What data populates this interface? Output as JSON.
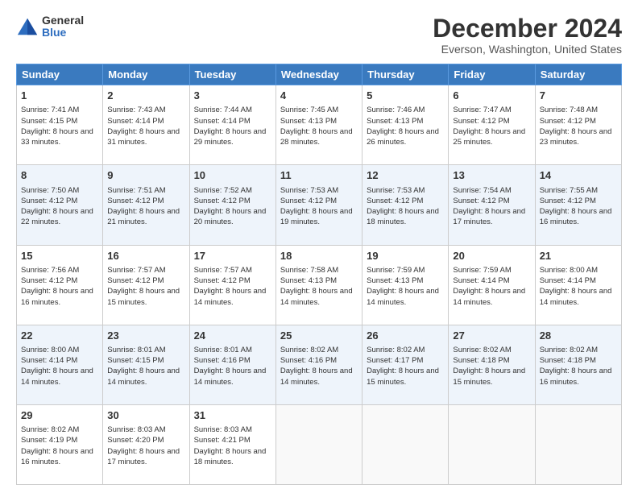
{
  "logo": {
    "general": "General",
    "blue": "Blue"
  },
  "title": "December 2024",
  "location": "Everson, Washington, United States",
  "days_header": [
    "Sunday",
    "Monday",
    "Tuesday",
    "Wednesday",
    "Thursday",
    "Friday",
    "Saturday"
  ],
  "weeks": [
    [
      {
        "day": "1",
        "sunrise": "Sunrise: 7:41 AM",
        "sunset": "Sunset: 4:15 PM",
        "daylight": "Daylight: 8 hours and 33 minutes."
      },
      {
        "day": "2",
        "sunrise": "Sunrise: 7:43 AM",
        "sunset": "Sunset: 4:14 PM",
        "daylight": "Daylight: 8 hours and 31 minutes."
      },
      {
        "day": "3",
        "sunrise": "Sunrise: 7:44 AM",
        "sunset": "Sunset: 4:14 PM",
        "daylight": "Daylight: 8 hours and 29 minutes."
      },
      {
        "day": "4",
        "sunrise": "Sunrise: 7:45 AM",
        "sunset": "Sunset: 4:13 PM",
        "daylight": "Daylight: 8 hours and 28 minutes."
      },
      {
        "day": "5",
        "sunrise": "Sunrise: 7:46 AM",
        "sunset": "Sunset: 4:13 PM",
        "daylight": "Daylight: 8 hours and 26 minutes."
      },
      {
        "day": "6",
        "sunrise": "Sunrise: 7:47 AM",
        "sunset": "Sunset: 4:12 PM",
        "daylight": "Daylight: 8 hours and 25 minutes."
      },
      {
        "day": "7",
        "sunrise": "Sunrise: 7:48 AM",
        "sunset": "Sunset: 4:12 PM",
        "daylight": "Daylight: 8 hours and 23 minutes."
      }
    ],
    [
      {
        "day": "8",
        "sunrise": "Sunrise: 7:50 AM",
        "sunset": "Sunset: 4:12 PM",
        "daylight": "Daylight: 8 hours and 22 minutes."
      },
      {
        "day": "9",
        "sunrise": "Sunrise: 7:51 AM",
        "sunset": "Sunset: 4:12 PM",
        "daylight": "Daylight: 8 hours and 21 minutes."
      },
      {
        "day": "10",
        "sunrise": "Sunrise: 7:52 AM",
        "sunset": "Sunset: 4:12 PM",
        "daylight": "Daylight: 8 hours and 20 minutes."
      },
      {
        "day": "11",
        "sunrise": "Sunrise: 7:53 AM",
        "sunset": "Sunset: 4:12 PM",
        "daylight": "Daylight: 8 hours and 19 minutes."
      },
      {
        "day": "12",
        "sunrise": "Sunrise: 7:53 AM",
        "sunset": "Sunset: 4:12 PM",
        "daylight": "Daylight: 8 hours and 18 minutes."
      },
      {
        "day": "13",
        "sunrise": "Sunrise: 7:54 AM",
        "sunset": "Sunset: 4:12 PM",
        "daylight": "Daylight: 8 hours and 17 minutes."
      },
      {
        "day": "14",
        "sunrise": "Sunrise: 7:55 AM",
        "sunset": "Sunset: 4:12 PM",
        "daylight": "Daylight: 8 hours and 16 minutes."
      }
    ],
    [
      {
        "day": "15",
        "sunrise": "Sunrise: 7:56 AM",
        "sunset": "Sunset: 4:12 PM",
        "daylight": "Daylight: 8 hours and 16 minutes."
      },
      {
        "day": "16",
        "sunrise": "Sunrise: 7:57 AM",
        "sunset": "Sunset: 4:12 PM",
        "daylight": "Daylight: 8 hours and 15 minutes."
      },
      {
        "day": "17",
        "sunrise": "Sunrise: 7:57 AM",
        "sunset": "Sunset: 4:12 PM",
        "daylight": "Daylight: 8 hours and 14 minutes."
      },
      {
        "day": "18",
        "sunrise": "Sunrise: 7:58 AM",
        "sunset": "Sunset: 4:13 PM",
        "daylight": "Daylight: 8 hours and 14 minutes."
      },
      {
        "day": "19",
        "sunrise": "Sunrise: 7:59 AM",
        "sunset": "Sunset: 4:13 PM",
        "daylight": "Daylight: 8 hours and 14 minutes."
      },
      {
        "day": "20",
        "sunrise": "Sunrise: 7:59 AM",
        "sunset": "Sunset: 4:14 PM",
        "daylight": "Daylight: 8 hours and 14 minutes."
      },
      {
        "day": "21",
        "sunrise": "Sunrise: 8:00 AM",
        "sunset": "Sunset: 4:14 PM",
        "daylight": "Daylight: 8 hours and 14 minutes."
      }
    ],
    [
      {
        "day": "22",
        "sunrise": "Sunrise: 8:00 AM",
        "sunset": "Sunset: 4:14 PM",
        "daylight": "Daylight: 8 hours and 14 minutes."
      },
      {
        "day": "23",
        "sunrise": "Sunrise: 8:01 AM",
        "sunset": "Sunset: 4:15 PM",
        "daylight": "Daylight: 8 hours and 14 minutes."
      },
      {
        "day": "24",
        "sunrise": "Sunrise: 8:01 AM",
        "sunset": "Sunset: 4:16 PM",
        "daylight": "Daylight: 8 hours and 14 minutes."
      },
      {
        "day": "25",
        "sunrise": "Sunrise: 8:02 AM",
        "sunset": "Sunset: 4:16 PM",
        "daylight": "Daylight: 8 hours and 14 minutes."
      },
      {
        "day": "26",
        "sunrise": "Sunrise: 8:02 AM",
        "sunset": "Sunset: 4:17 PM",
        "daylight": "Daylight: 8 hours and 15 minutes."
      },
      {
        "day": "27",
        "sunrise": "Sunrise: 8:02 AM",
        "sunset": "Sunset: 4:18 PM",
        "daylight": "Daylight: 8 hours and 15 minutes."
      },
      {
        "day": "28",
        "sunrise": "Sunrise: 8:02 AM",
        "sunset": "Sunset: 4:18 PM",
        "daylight": "Daylight: 8 hours and 16 minutes."
      }
    ],
    [
      {
        "day": "29",
        "sunrise": "Sunrise: 8:02 AM",
        "sunset": "Sunset: 4:19 PM",
        "daylight": "Daylight: 8 hours and 16 minutes."
      },
      {
        "day": "30",
        "sunrise": "Sunrise: 8:03 AM",
        "sunset": "Sunset: 4:20 PM",
        "daylight": "Daylight: 8 hours and 17 minutes."
      },
      {
        "day": "31",
        "sunrise": "Sunrise: 8:03 AM",
        "sunset": "Sunset: 4:21 PM",
        "daylight": "Daylight: 8 hours and 18 minutes."
      },
      null,
      null,
      null,
      null
    ]
  ]
}
